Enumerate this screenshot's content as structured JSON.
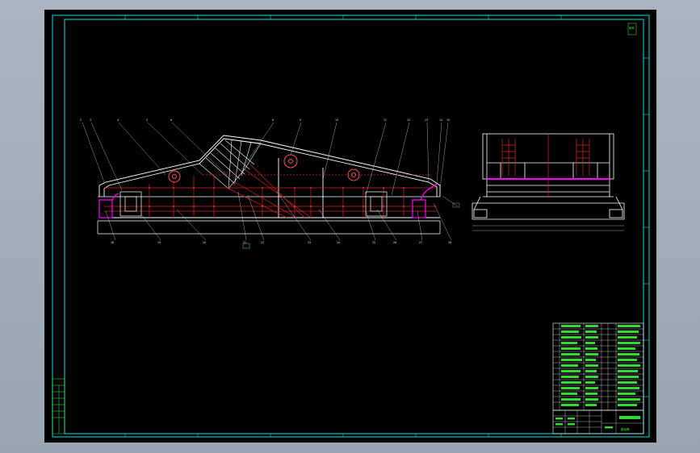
{
  "drawing": {
    "colors": {
      "background": "#000000",
      "viewport": "#a9b3bf",
      "frame": "#00e5e5",
      "structure": "#ffffff",
      "members": "#e02020",
      "accent": "#ff00ff",
      "hatch": "#ff7070",
      "text": "#3aff3a"
    },
    "stamp_text": "部件",
    "callouts_top": [
      "2",
      "3",
      "4",
      "5",
      "6",
      "8",
      "9",
      "10",
      "11",
      "12",
      "13",
      "14",
      "15"
    ],
    "callouts_bottom": [
      "18",
      "19",
      "20",
      "21",
      "22",
      "23",
      "24",
      "25",
      "26",
      "27",
      "28"
    ],
    "parts_list_rows": 15,
    "title_block_label": "振动筛"
  }
}
